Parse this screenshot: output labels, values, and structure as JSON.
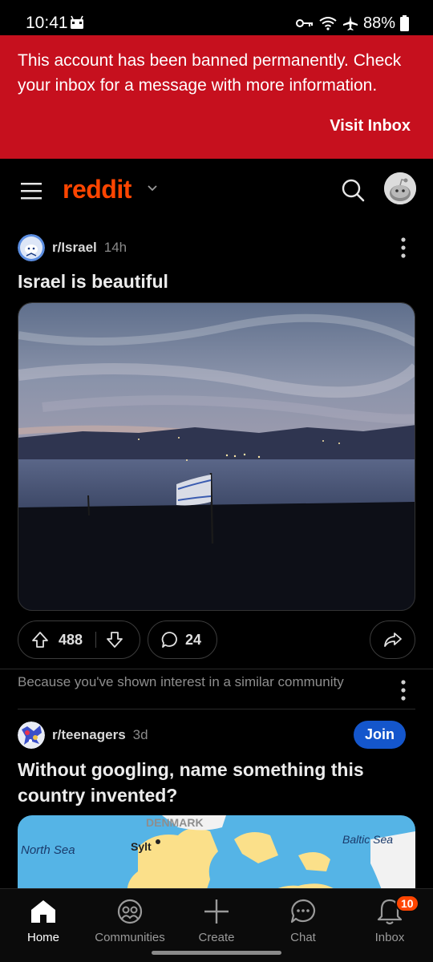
{
  "status_bar": {
    "time": "10:41",
    "battery": "88%",
    "icons": [
      "android-icon",
      "key-icon",
      "wifi-icon",
      "airplane-icon",
      "battery-icon"
    ]
  },
  "banner": {
    "message": "This account has been banned permanently. Check your inbox for a message with more information.",
    "action": "Visit Inbox",
    "color": "#c6101e"
  },
  "header": {
    "logo": "reddit",
    "brand_color": "#ff4500",
    "icons": [
      "menu-icon",
      "chevron-down-icon",
      "search-icon",
      "avatar"
    ]
  },
  "feed": {
    "post1": {
      "subreddit": "r/Israel",
      "age": "14h",
      "title": "Israel is beautiful",
      "upvotes": "488",
      "comments": "24"
    },
    "recommendation_reason": "Because you've shown interest in a similar community",
    "post2": {
      "subreddit": "r/teenagers",
      "age": "3d",
      "join_label": "Join",
      "title": "Without googling, name something this country invented?",
      "map_labels": {
        "north_sea": "North Sea",
        "sylt": "Sylt",
        "denmark": "DENMARK",
        "baltic_sea": "Baltic Sea"
      }
    }
  },
  "bottom_nav": {
    "items": [
      {
        "label": "Home",
        "active": true
      },
      {
        "label": "Communities"
      },
      {
        "label": "Create"
      },
      {
        "label": "Chat"
      },
      {
        "label": "Inbox",
        "badge": "10"
      }
    ]
  }
}
